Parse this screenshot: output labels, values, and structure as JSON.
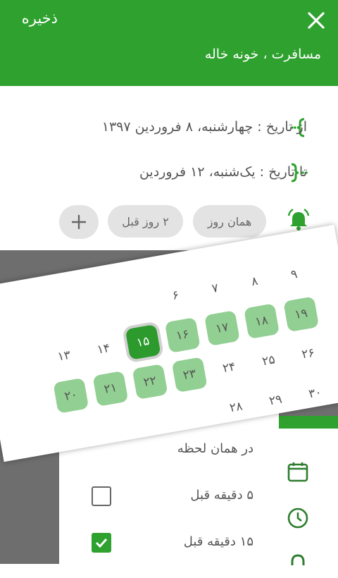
{
  "header": {
    "save_label": "ذخیره",
    "subtitle": "مسافرت ، خونه خاله"
  },
  "event": {
    "from_label": "از تاریخ : چهارشنبه، ۸ فروردین ۱۳۹۷",
    "to_label": "تا تاریخ : یک‌شنبه، ۱۲ فروردین"
  },
  "reminders": {
    "chip_same_day": "همان روز",
    "chip_two_days": "۲ روز قبل"
  },
  "alert_options": [
    {
      "label": "در همان لحظه",
      "checked": false
    },
    {
      "label": "۵ دقیقه قبل",
      "checked": false
    },
    {
      "label": "۱۵ دقیقه قبل",
      "checked": true
    }
  ],
  "calendar": {
    "rows": [
      [
        "۹",
        "۸",
        "۷",
        "۶"
      ],
      [
        "۱۹",
        "۱۸",
        "۱۷",
        "۱۶",
        "۱۵",
        "۱۴",
        "۱۳"
      ],
      [
        "۲۶",
        "۲۵",
        "۲۴",
        "۲۳",
        "۲۲",
        "۲۱",
        "۲۰"
      ],
      [
        "۳۰",
        "۲۹",
        "۲۸"
      ]
    ],
    "selected": "۱۵",
    "range": [
      "۱۶",
      "۱۷",
      "۱۸",
      "۱۹",
      "۲۰",
      "۲۱",
      "۲۲",
      "۲۳"
    ]
  },
  "colors": {
    "primary": "#2ea12e",
    "range": "#92cf92",
    "chip_bg": "#e3e3e3"
  }
}
